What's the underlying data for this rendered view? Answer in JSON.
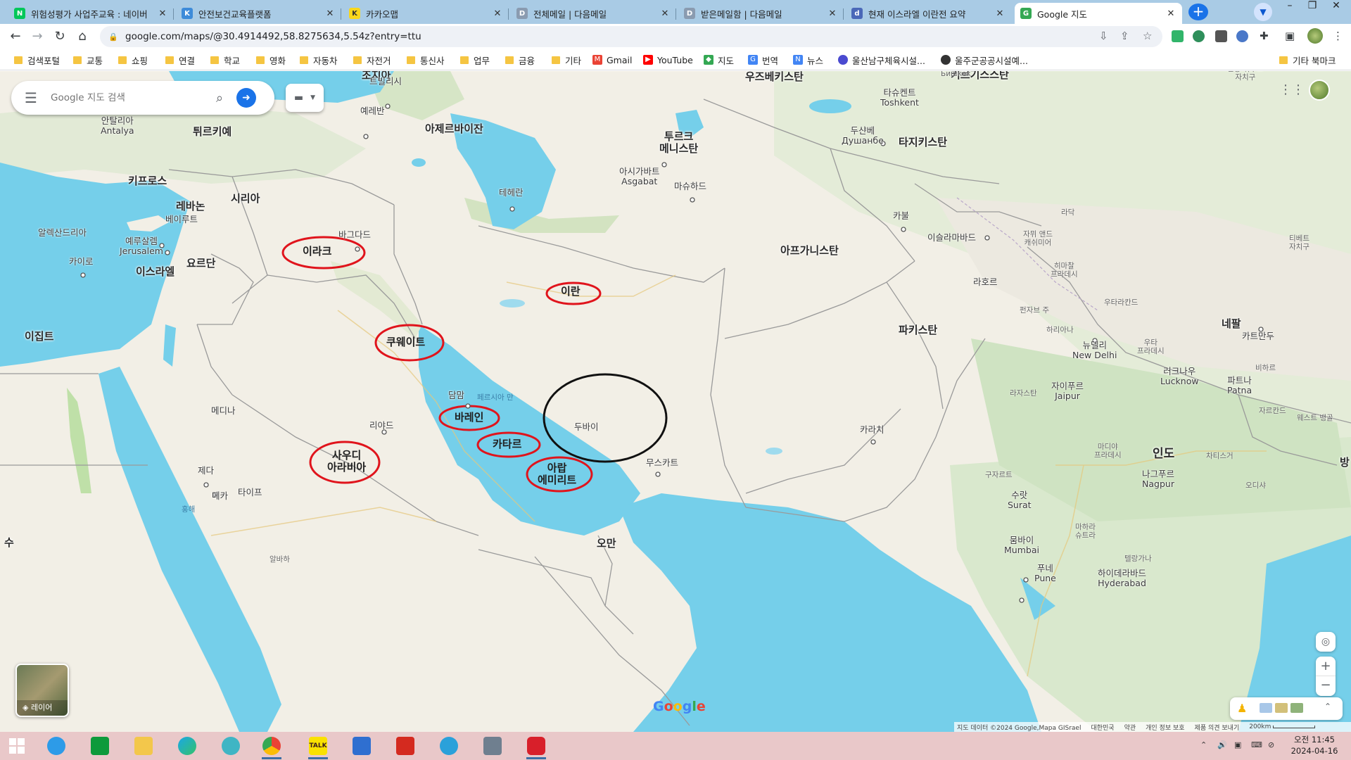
{
  "browser": {
    "tabs": [
      {
        "title": "위험성평가 사업주교육 : 네이버",
        "icon": "naver-icon",
        "color": "#03c75a",
        "glyph": "N"
      },
      {
        "title": "안전보건교육플랫폼",
        "icon": "kosha-icon",
        "color": "#3d8bd9",
        "glyph": "K"
      },
      {
        "title": "카카오맵",
        "icon": "kakaomap-icon",
        "color": "#f9d71c",
        "glyph": "K"
      },
      {
        "title": "전체메일 | 다음메일",
        "icon": "daum-mail-icon",
        "color": "#8a9bb0",
        "glyph": "D"
      },
      {
        "title": "받은메일함 | 다음메일",
        "icon": "daum-mail-icon",
        "color": "#8a9bb0",
        "glyph": "D"
      },
      {
        "title": "현재 이스라엘 이란전 요약",
        "icon": "dcinside-icon",
        "color": "#4a68b8",
        "glyph": "d"
      },
      {
        "title": "Google 지도",
        "icon": "google-maps-icon",
        "color": "#34a853",
        "glyph": "G"
      }
    ],
    "url": "google.com/maps/@30.4914492,58.8275634,5.54z?entry=ttu",
    "bookmarks": [
      {
        "label": "검색포털",
        "type": "folder"
      },
      {
        "label": "교통",
        "type": "folder"
      },
      {
        "label": "쇼핑",
        "type": "folder"
      },
      {
        "label": "연결",
        "type": "folder"
      },
      {
        "label": "학교",
        "type": "folder"
      },
      {
        "label": "영화",
        "type": "folder"
      },
      {
        "label": "자동차",
        "type": "folder"
      },
      {
        "label": "자전거",
        "type": "folder"
      },
      {
        "label": "통신사",
        "type": "folder"
      },
      {
        "label": "업무",
        "type": "folder"
      },
      {
        "label": "금융",
        "type": "folder"
      },
      {
        "label": "기타",
        "type": "folder"
      },
      {
        "label": "Gmail",
        "type": "site",
        "icon": "gmail-icon",
        "color": "#ea4335",
        "glyph": "M"
      },
      {
        "label": "YouTube",
        "type": "site",
        "icon": "youtube-icon",
        "color": "#ff0000",
        "glyph": "▶"
      },
      {
        "label": "지도",
        "type": "site",
        "icon": "google-maps-icon",
        "color": "#34a853",
        "glyph": "◆"
      },
      {
        "label": "번역",
        "type": "site",
        "icon": "translate-icon",
        "color": "#4285f4",
        "glyph": "G"
      },
      {
        "label": "뉴스",
        "type": "site",
        "icon": "news-icon",
        "color": "#4285f4",
        "glyph": "N"
      },
      {
        "label": "울산남구체육시설...",
        "type": "site",
        "icon": "site-icon",
        "color": "#4a4ad0",
        "glyph": "●"
      },
      {
        "label": "울주군공공시설예...",
        "type": "site",
        "icon": "globe-icon",
        "color": "#333333",
        "glyph": "●"
      }
    ],
    "other_bookmarks": "기타 북마크"
  },
  "maps": {
    "search_placeholder": "Google 지도 검색",
    "layers_label": "레이어",
    "logo": "Google",
    "attribution": [
      "지도 데이터 ©2024 Google,Mapa GISrael",
      "대한민국",
      "약관",
      "개인 정보 보호",
      "제품 의견 보내기",
      "200km"
    ],
    "labels": {
      "countries": [
        "조지아",
        "아제르바이잔",
        "튀르키예",
        "키프로스",
        "시리아",
        "레바논",
        "이스라엘",
        "요르단",
        "이집트",
        "투르크\n메니스탄",
        "우즈베키스탄",
        "키르기스스탄",
        "타지키스탄",
        "아프가니스탄",
        "파키스탄",
        "네팔",
        "인도",
        "오만",
        "방"
      ],
      "circled": [
        "이라크",
        "이란",
        "쿠웨이트",
        "바레인",
        "카타르",
        "사우디\n아라비아",
        "아랍\n에미리트"
      ],
      "cities": [
        "트빌리시",
        "예레반",
        "안탈리아\nAntalya",
        "베이루트",
        "예루살렘\nJerusalem",
        "알렉산드리아",
        "카이로",
        "바그다드",
        "테헤란",
        "아시가바트\nAsgabat",
        "마슈하드",
        "타슈켄트\nToshkent",
        "두샨베\nДушанбе",
        "카불",
        "이슬라마바드",
        "라호르",
        "뉴델리\nNew Delhi",
        "자이푸르\nJaipur",
        "러크나우\nLucknow",
        "파트나\nPatna",
        "카트만두",
        "담맘",
        "리야드",
        "메디나",
        "제다",
        "메카",
        "타이프",
        "두바이",
        "무스카트",
        "카라치",
        "수랏\nSurat",
        "뭄바이\nMumbai",
        "푸네\nPune",
        "하이데라바드\nHyderabad",
        "나그푸르\nNagpur",
        "구자르트",
        "Бишкек",
        "수"
      ],
      "seas": [
        "페르시아 만",
        "홍해"
      ],
      "regions": [
        "신장 위구르\n자치구",
        "티베트\n자치구",
        "라닥",
        "자뮈 앤드\n캐쉬미어",
        "히마찰\n프라데시",
        "펀자브 주",
        "우타라칸드",
        "하리아나",
        "우타\n프라데시",
        "비하르",
        "자르칸드",
        "라자스탄",
        "마디야\n프라데시",
        "마하라\n슈트라",
        "텔랑가나",
        "차티스거",
        "오디샤",
        "웨스트 뱅골",
        "알바하",
        "테헤란"
      ]
    }
  },
  "taskbar": {
    "time": "오전 11:45",
    "date": "2024-04-16",
    "apps": [
      "windows-start-icon",
      "ie-icon",
      "store-icon",
      "file-explorer-icon",
      "edge-icon",
      "swift-icon",
      "chrome-icon",
      "kakaotalk-icon",
      "hwp-icon",
      "acrobat-icon",
      "telegram-icon",
      "calculator-icon",
      "screen-recorder-icon"
    ]
  }
}
